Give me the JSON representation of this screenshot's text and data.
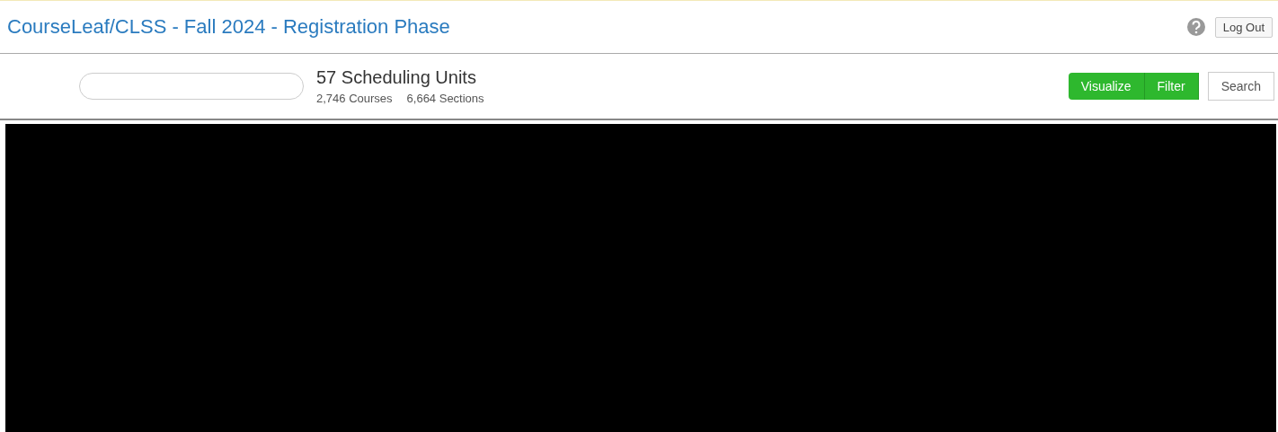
{
  "header": {
    "title": "CourseLeaf/CLSS - Fall 2024 - Registration Phase",
    "logout": "Log Out"
  },
  "toolbar": {
    "summary": {
      "title": "57 Scheduling Units",
      "counts": [
        "2,746 Courses",
        "6,664 Sections"
      ]
    },
    "buttons": [
      {
        "label": "Visualize",
        "kind": "green"
      },
      {
        "label": "Filter",
        "kind": "green"
      },
      {
        "label": "Search",
        "kind": "plain"
      }
    ]
  }
}
